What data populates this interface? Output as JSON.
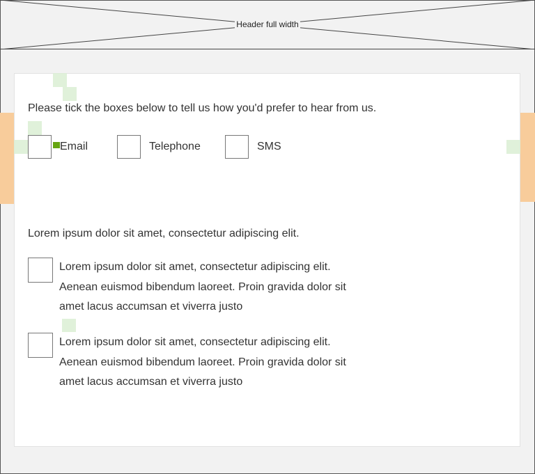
{
  "header": {
    "placeholder_label": "Header full width"
  },
  "contact_preferences": {
    "prompt": "Please tick the boxes below to tell us how you'd prefer to hear from us.",
    "options": [
      {
        "label": "Email",
        "checked": false
      },
      {
        "label": "Telephone",
        "checked": false
      },
      {
        "label": "SMS",
        "checked": false
      }
    ]
  },
  "consent": {
    "intro": "Lorem ipsum dolor sit amet, consectetur adipiscing elit.",
    "items": [
      {
        "text": "Lorem ipsum dolor sit amet, consectetur adipiscing elit. Aenean euismod bibendum laoreet. Proin gravida dolor sit amet lacus accumsan et viverra justo",
        "checked": false
      },
      {
        "text": "Lorem ipsum dolor sit amet, consectetur adipiscing elit. Aenean euismod bibendum laoreet. Proin gravida dolor sit amet lacus accumsan et viverra justo",
        "checked": false
      }
    ]
  },
  "colors": {
    "background": "#f2f2f2",
    "card": "#ffffff",
    "margin_marker": "#f8cc9b",
    "spacing_marker": "#dbeed4",
    "focus_dot": "#66a512"
  }
}
